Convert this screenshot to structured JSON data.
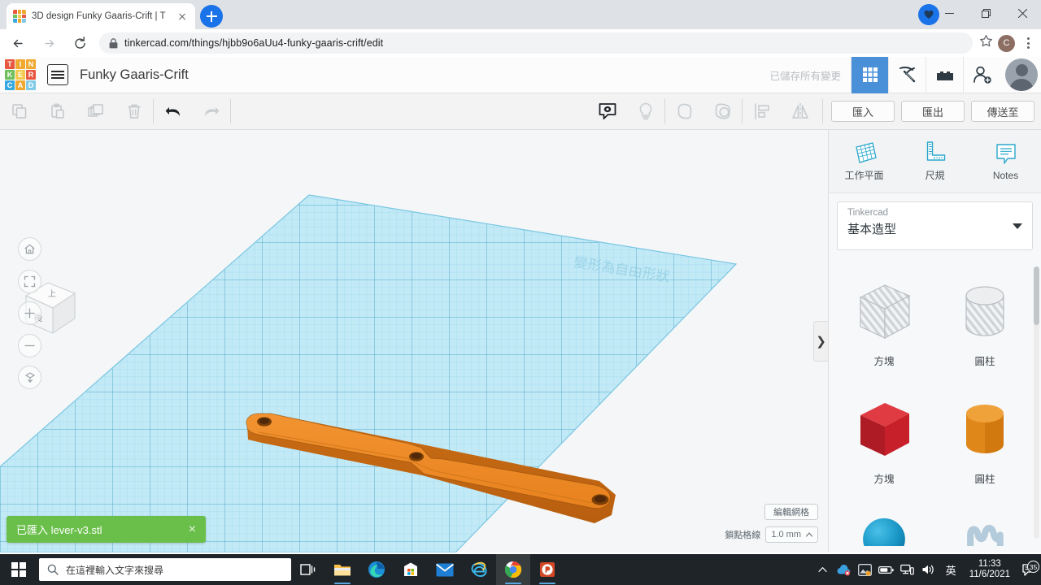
{
  "browser": {
    "tab": {
      "title": "3D design Funky Gaaris-Crift | T",
      "favicon": "tinkercad-favicon"
    },
    "newtab_label": "+",
    "url": "tinkercad.com/things/hjbb9o6aUu4-funky-gaaris-crift/edit",
    "profile_initial": "C",
    "window_buttons": [
      "minimize",
      "restore",
      "close"
    ]
  },
  "tinkercad": {
    "logo_letters": [
      "T",
      "I",
      "N",
      "K",
      "E",
      "R",
      "C",
      "A",
      "D"
    ],
    "logo_colors": [
      "#e8573f",
      "#f0a830",
      "#f0a830",
      "#6cbf5a",
      "#f2c94c",
      "#e8573f",
      "#37a9e0",
      "#f0a830",
      "#7fcbe8"
    ],
    "project_title": "Funky Gaaris-Crift",
    "save_status": "已儲存所有變更",
    "header_icons": [
      "grid-icon",
      "pickaxe-icon",
      "blocks-icon",
      "add-user-icon",
      "user-avatar"
    ],
    "toolbar": {
      "left_icons": [
        "copy-icon",
        "paste-icon",
        "duplicate-icon",
        "delete-icon",
        "undo-icon",
        "redo-icon"
      ],
      "right_icons": [
        "comment-icon",
        "light-bulb-icon",
        "group-icon",
        "ungroup-icon",
        "align-icon",
        "mirror-icon"
      ],
      "import_label": "匯入",
      "export_label": "匯出",
      "sendto_label": "傳送至"
    },
    "canvas": {
      "viewcube_faces": {
        "top": "上",
        "front": "後"
      },
      "nav_icons": [
        "home-icon",
        "fit-view-icon",
        "zoom-in-icon",
        "zoom-out-icon",
        "ortho-view-icon"
      ],
      "watermark": "變形為自由形狀",
      "model_name": "lever-v3",
      "model_color": "#e8821e",
      "grid_color": "#a8dff0",
      "edit_grid_label": "編輯網格",
      "snap_label": "鎖點格線",
      "snap_value": "1.0 mm",
      "collapse_icon": "chevron-right-icon"
    },
    "toast": {
      "message": "已匯入 lever-v3.stl",
      "close_icon": "close-icon",
      "color": "#6abf4b"
    },
    "right_panel": {
      "tools": [
        {
          "label": "工作平面",
          "icon": "workplane-icon"
        },
        {
          "label": "尺規",
          "icon": "ruler-icon"
        },
        {
          "label": "Notes",
          "icon": "notes-icon"
        }
      ],
      "library_sub": "Tinkercad",
      "library_main": "基本造型",
      "shapes": [
        {
          "label": "方塊",
          "icon": "hole-box-icon",
          "color": "#c9ccd0",
          "kind": "box",
          "hole": true
        },
        {
          "label": "圓柱",
          "icon": "hole-cylinder-icon",
          "color": "#c9ccd0",
          "kind": "cylinder",
          "hole": true
        },
        {
          "label": "方塊",
          "icon": "solid-box-icon",
          "color": "#c8202a",
          "kind": "box",
          "hole": false
        },
        {
          "label": "圓柱",
          "icon": "solid-cylinder-icon",
          "color": "#e8921e",
          "kind": "cylinder",
          "hole": false
        },
        {
          "label": "",
          "icon": "sphere-icon",
          "color": "#1794c4",
          "kind": "sphere",
          "hole": false
        },
        {
          "label": "",
          "icon": "scribble-icon",
          "color": "#b9cfe0",
          "kind": "scribble",
          "hole": false
        }
      ]
    }
  },
  "taskbar": {
    "search_placeholder": "在這裡輸入文字來搜尋",
    "apps": [
      "task-view-icon",
      "file-explorer-icon",
      "edge-icon",
      "microsoft-store-icon",
      "mail-icon",
      "internet-explorer-icon",
      "chrome-icon",
      "powerpoint-icon"
    ],
    "tray_icons": [
      "chevron-up-icon",
      "onedrive-icon",
      "photos-icon",
      "battery-icon",
      "network-icon",
      "volume-icon"
    ],
    "ime": "英",
    "time": "11:33",
    "date": "11/6/2021",
    "notification_count": "35"
  }
}
